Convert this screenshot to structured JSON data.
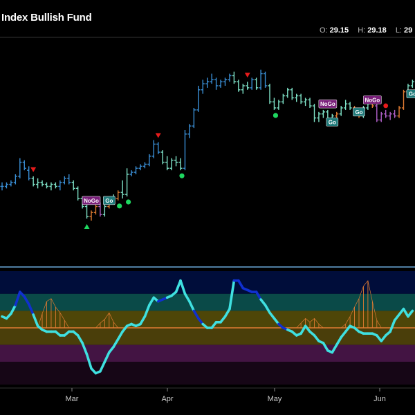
{
  "header": {
    "title": "Index Bullish Fund",
    "ohlc": [
      {
        "key": "O:",
        "value": "29.15"
      },
      {
        "key": "H:",
        "value": "29.18"
      },
      {
        "key": "L:",
        "value": "29"
      }
    ]
  },
  "colors": {
    "background": "#000000",
    "strong_go": "#3a8fd6",
    "go": "#7fe3c8",
    "nogo": "#8b44a8",
    "strong_nogo": "#b060c8",
    "neutral": "#e07b32",
    "signal_up": "#1ed760",
    "signal_down": "#e81b1b",
    "oscillator": "#3fe0e0",
    "oscillator_strong": "#1030d0",
    "zero_line": "#e07b32",
    "separator": "#6aa8d8"
  },
  "chart_data": [
    {
      "type": "ohlc",
      "title": "Index Bullish Fund",
      "x_ticks": [
        "Mar",
        "Apr",
        "May",
        "Jun"
      ],
      "ylim": [
        26.0,
        31.5
      ],
      "bars": [
        {
          "o": 27.9,
          "h": 28.0,
          "l": 27.8,
          "c": 27.9,
          "s": "sg"
        },
        {
          "o": 27.9,
          "h": 28.0,
          "l": 27.85,
          "c": 27.95,
          "s": "sg"
        },
        {
          "o": 27.95,
          "h": 28.05,
          "l": 27.9,
          "c": 28.0,
          "s": "sg"
        },
        {
          "o": 28.0,
          "h": 28.2,
          "l": 27.95,
          "c": 28.15,
          "s": "sg"
        },
        {
          "o": 28.15,
          "h": 28.6,
          "l": 28.1,
          "c": 28.5,
          "s": "sg"
        },
        {
          "o": 28.5,
          "h": 28.55,
          "l": 28.3,
          "c": 28.35,
          "s": "sg"
        },
        {
          "o": 28.3,
          "h": 28.4,
          "l": 28.05,
          "c": 28.1,
          "s": "sg"
        },
        {
          "o": 28.1,
          "h": 28.15,
          "l": 27.9,
          "c": 27.95,
          "s": "g"
        },
        {
          "o": 27.95,
          "h": 28.1,
          "l": 27.85,
          "c": 28.0,
          "s": "g"
        },
        {
          "o": 28.0,
          "h": 28.05,
          "l": 27.9,
          "c": 27.95,
          "s": "g"
        },
        {
          "o": 27.95,
          "h": 28.0,
          "l": 27.85,
          "c": 27.9,
          "s": "g"
        },
        {
          "o": 27.9,
          "h": 28.0,
          "l": 27.8,
          "c": 27.95,
          "s": "g"
        },
        {
          "o": 27.95,
          "h": 28.0,
          "l": 27.85,
          "c": 27.9,
          "s": "g"
        },
        {
          "o": 27.9,
          "h": 28.05,
          "l": 27.8,
          "c": 28.0,
          "s": "sg"
        },
        {
          "o": 28.0,
          "h": 28.15,
          "l": 27.95,
          "c": 28.1,
          "s": "sg"
        },
        {
          "o": 28.1,
          "h": 28.2,
          "l": 27.95,
          "c": 28.0,
          "s": "sg"
        },
        {
          "o": 28.0,
          "h": 28.05,
          "l": 27.8,
          "c": 27.85,
          "s": "g"
        },
        {
          "o": 27.85,
          "h": 27.9,
          "l": 27.55,
          "c": 27.6,
          "s": "g"
        },
        {
          "o": 27.6,
          "h": 27.65,
          "l": 27.35,
          "c": 27.4,
          "s": "g"
        },
        {
          "o": 27.4,
          "h": 27.45,
          "l": 27.1,
          "c": 27.15,
          "s": "g"
        },
        {
          "o": 27.15,
          "h": 27.3,
          "l": 27.05,
          "c": 27.25,
          "s": "n"
        },
        {
          "o": 27.25,
          "h": 27.45,
          "l": 27.2,
          "c": 27.4,
          "s": "n"
        },
        {
          "o": 27.4,
          "h": 27.5,
          "l": 27.15,
          "c": 27.2,
          "s": "sn"
        },
        {
          "o": 27.2,
          "h": 27.45,
          "l": 27.15,
          "c": 27.4,
          "s": "g"
        },
        {
          "o": 27.4,
          "h": 27.6,
          "l": 27.35,
          "c": 27.55,
          "s": "n"
        },
        {
          "o": 27.55,
          "h": 27.7,
          "l": 27.45,
          "c": 27.6,
          "s": "g"
        },
        {
          "o": 27.6,
          "h": 27.8,
          "l": 27.55,
          "c": 27.75,
          "s": "n"
        },
        {
          "o": 27.75,
          "h": 28.05,
          "l": 27.6,
          "c": 27.7,
          "s": "g"
        },
        {
          "o": 27.7,
          "h": 28.35,
          "l": 27.65,
          "c": 28.2,
          "s": "g"
        },
        {
          "o": 28.2,
          "h": 28.3,
          "l": 28.15,
          "c": 28.25,
          "s": "sg"
        },
        {
          "o": 28.25,
          "h": 28.4,
          "l": 28.2,
          "c": 28.35,
          "s": "sg"
        },
        {
          "o": 28.35,
          "h": 28.45,
          "l": 28.3,
          "c": 28.4,
          "s": "sg"
        },
        {
          "o": 28.4,
          "h": 28.5,
          "l": 28.35,
          "c": 28.45,
          "s": "sg"
        },
        {
          "o": 28.45,
          "h": 28.7,
          "l": 28.4,
          "c": 28.65,
          "s": "sg"
        },
        {
          "o": 28.65,
          "h": 29.05,
          "l": 28.6,
          "c": 28.95,
          "s": "sg"
        },
        {
          "o": 28.95,
          "h": 29.0,
          "l": 28.7,
          "c": 28.75,
          "s": "sg"
        },
        {
          "o": 28.75,
          "h": 28.8,
          "l": 28.45,
          "c": 28.5,
          "s": "g"
        },
        {
          "o": 28.5,
          "h": 28.65,
          "l": 28.3,
          "c": 28.35,
          "s": "g"
        },
        {
          "o": 28.35,
          "h": 28.6,
          "l": 28.3,
          "c": 28.55,
          "s": "g"
        },
        {
          "o": 28.55,
          "h": 28.65,
          "l": 28.4,
          "c": 28.5,
          "s": "g"
        },
        {
          "o": 28.5,
          "h": 28.6,
          "l": 28.3,
          "c": 28.35,
          "s": "g"
        },
        {
          "o": 28.35,
          "h": 29.3,
          "l": 28.3,
          "c": 29.2,
          "s": "sg"
        },
        {
          "o": 29.2,
          "h": 29.45,
          "l": 29.1,
          "c": 29.4,
          "s": "sg"
        },
        {
          "o": 29.4,
          "h": 29.85,
          "l": 29.35,
          "c": 29.8,
          "s": "sg"
        },
        {
          "o": 29.8,
          "h": 30.4,
          "l": 29.75,
          "c": 30.3,
          "s": "sg"
        },
        {
          "o": 30.3,
          "h": 30.55,
          "l": 30.2,
          "c": 30.45,
          "s": "sg"
        },
        {
          "o": 30.45,
          "h": 30.6,
          "l": 30.35,
          "c": 30.5,
          "s": "sg"
        },
        {
          "o": 30.5,
          "h": 30.7,
          "l": 30.45,
          "c": 30.55,
          "s": "sg"
        },
        {
          "o": 30.55,
          "h": 30.6,
          "l": 30.3,
          "c": 30.4,
          "s": "sg"
        },
        {
          "o": 30.4,
          "h": 30.55,
          "l": 30.35,
          "c": 30.5,
          "s": "sg"
        },
        {
          "o": 30.5,
          "h": 30.6,
          "l": 30.4,
          "c": 30.55,
          "s": "sg"
        },
        {
          "o": 30.55,
          "h": 30.7,
          "l": 30.5,
          "c": 30.65,
          "s": "sg"
        },
        {
          "o": 30.65,
          "h": 30.75,
          "l": 30.45,
          "c": 30.5,
          "s": "g"
        },
        {
          "o": 30.5,
          "h": 30.55,
          "l": 30.25,
          "c": 30.3,
          "s": "g"
        },
        {
          "o": 30.3,
          "h": 30.45,
          "l": 30.2,
          "c": 30.4,
          "s": "g"
        },
        {
          "o": 30.4,
          "h": 30.5,
          "l": 30.3,
          "c": 30.35,
          "s": "g"
        },
        {
          "o": 30.35,
          "h": 30.6,
          "l": 30.3,
          "c": 30.55,
          "s": "sg"
        },
        {
          "o": 30.55,
          "h": 30.6,
          "l": 30.3,
          "c": 30.35,
          "s": "g"
        },
        {
          "o": 30.35,
          "h": 30.8,
          "l": 30.3,
          "c": 30.7,
          "s": "sg"
        },
        {
          "o": 30.7,
          "h": 30.75,
          "l": 30.35,
          "c": 30.4,
          "s": "sg"
        },
        {
          "o": 30.4,
          "h": 30.45,
          "l": 29.95,
          "c": 30.0,
          "s": "g"
        },
        {
          "o": 30.0,
          "h": 30.1,
          "l": 29.8,
          "c": 29.85,
          "s": "g"
        },
        {
          "o": 29.85,
          "h": 30.05,
          "l": 29.8,
          "c": 30.0,
          "s": "g"
        },
        {
          "o": 30.0,
          "h": 30.2,
          "l": 29.95,
          "c": 30.15,
          "s": "g"
        },
        {
          "o": 30.15,
          "h": 30.35,
          "l": 30.1,
          "c": 30.3,
          "s": "g"
        },
        {
          "o": 30.3,
          "h": 30.35,
          "l": 30.05,
          "c": 30.1,
          "s": "g"
        },
        {
          "o": 30.1,
          "h": 30.2,
          "l": 30.0,
          "c": 30.15,
          "s": "g"
        },
        {
          "o": 30.15,
          "h": 30.2,
          "l": 29.95,
          "c": 30.0,
          "s": "g"
        },
        {
          "o": 30.0,
          "h": 30.1,
          "l": 29.9,
          "c": 30.05,
          "s": "g"
        },
        {
          "o": 30.05,
          "h": 30.1,
          "l": 29.85,
          "c": 29.9,
          "s": "g"
        },
        {
          "o": 29.9,
          "h": 29.95,
          "l": 29.5,
          "c": 29.6,
          "s": "g"
        },
        {
          "o": 29.6,
          "h": 29.75,
          "l": 29.5,
          "c": 29.7,
          "s": "g"
        },
        {
          "o": 29.7,
          "h": 29.8,
          "l": 29.6,
          "c": 29.75,
          "s": "g"
        },
        {
          "o": 29.75,
          "h": 29.8,
          "l": 29.55,
          "c": 29.6,
          "s": "g"
        },
        {
          "o": 29.6,
          "h": 29.7,
          "l": 29.5,
          "c": 29.65,
          "s": "g"
        },
        {
          "o": 29.65,
          "h": 29.75,
          "l": 29.6,
          "c": 29.7,
          "s": "n"
        },
        {
          "o": 29.7,
          "h": 29.9,
          "l": 29.65,
          "c": 29.85,
          "s": "g"
        },
        {
          "o": 29.85,
          "h": 30.05,
          "l": 29.8,
          "c": 29.95,
          "s": "g"
        },
        {
          "o": 29.95,
          "h": 30.0,
          "l": 29.8,
          "c": 29.85,
          "s": "g"
        },
        {
          "o": 29.85,
          "h": 29.9,
          "l": 29.65,
          "c": 29.7,
          "s": "n"
        },
        {
          "o": 29.7,
          "h": 29.75,
          "l": 29.6,
          "c": 29.65,
          "s": "n"
        },
        {
          "o": 29.65,
          "h": 29.9,
          "l": 29.6,
          "c": 29.85,
          "s": "g"
        },
        {
          "o": 29.85,
          "h": 30.0,
          "l": 29.8,
          "c": 29.95,
          "s": "g"
        },
        {
          "o": 29.95,
          "h": 30.05,
          "l": 29.85,
          "c": 29.9,
          "s": "n"
        },
        {
          "o": 29.9,
          "h": 29.95,
          "l": 29.5,
          "c": 29.55,
          "s": "sn"
        },
        {
          "o": 29.55,
          "h": 29.75,
          "l": 29.5,
          "c": 29.7,
          "s": "sn"
        },
        {
          "o": 29.7,
          "h": 29.8,
          "l": 29.6,
          "c": 29.65,
          "s": "sn"
        },
        {
          "o": 29.65,
          "h": 29.75,
          "l": 29.55,
          "c": 29.7,
          "s": "sn"
        },
        {
          "o": 29.7,
          "h": 29.8,
          "l": 29.6,
          "c": 29.65,
          "s": "sn"
        },
        {
          "o": 29.65,
          "h": 29.9,
          "l": 29.6,
          "c": 29.85,
          "s": "n"
        },
        {
          "o": 29.85,
          "h": 30.3,
          "l": 29.8,
          "c": 30.25,
          "s": "n"
        },
        {
          "o": 30.25,
          "h": 30.45,
          "l": 30.2,
          "c": 30.4,
          "s": "g"
        },
        {
          "o": 30.4,
          "h": 30.55,
          "l": 30.35,
          "c": 30.5,
          "s": "g"
        }
      ],
      "signals": [
        {
          "bar": 7,
          "type": "down"
        },
        {
          "bar": 19,
          "type": "up"
        },
        {
          "bar": 26,
          "type": "dot"
        },
        {
          "bar": 28,
          "type": "dot"
        },
        {
          "bar": 35,
          "type": "down"
        },
        {
          "bar": 40,
          "type": "dot"
        },
        {
          "bar": 55,
          "type": "down"
        },
        {
          "bar": 61,
          "type": "dot"
        },
        {
          "bar": 86,
          "type": "redot"
        }
      ],
      "labels": [
        {
          "bar": 20,
          "text": "NoGo",
          "kind": "nogo",
          "price": 27.55
        },
        {
          "bar": 24,
          "text": "Go",
          "kind": "go",
          "price": 27.55
        },
        {
          "bar": 73,
          "text": "NoGo",
          "kind": "nogo",
          "price": 29.95
        },
        {
          "bar": 74,
          "text": "Go",
          "kind": "go",
          "price": 29.5
        },
        {
          "bar": 80,
          "text": "Go",
          "kind": "go",
          "price": 29.75
        },
        {
          "bar": 83,
          "text": "NoGo",
          "kind": "nogo",
          "price": 30.05
        },
        {
          "bar": 92,
          "text": "Go",
          "kind": "go",
          "price": 30.2
        }
      ]
    },
    {
      "type": "line",
      "title": "",
      "x_ticks": [
        "Mar",
        "Apr",
        "May",
        "Jun"
      ],
      "ylim": [
        -6,
        6
      ],
      "zero_line": 0,
      "oscillator": [
        1.2,
        1.0,
        1.5,
        2.4,
        3.8,
        3.3,
        2.5,
        1.4,
        0.2,
        -0.2,
        -0.4,
        -0.4,
        -0.4,
        -0.8,
        -0.8,
        -0.4,
        -0.4,
        -0.8,
        -1.6,
        -2.8,
        -4.3,
        -4.8,
        -4.6,
        -3.6,
        -2.6,
        -2.0,
        -1.2,
        -0.4,
        0.2,
        0.4,
        0.2,
        0.4,
        1.2,
        2.4,
        3.2,
        2.8,
        3.0,
        3.2,
        3.4,
        3.8,
        5.0,
        3.6,
        2.8,
        1.8,
        1.0,
        0.4,
        0.0,
        0.0,
        0.6,
        0.6,
        1.2,
        2.0,
        5.0,
        5.0,
        4.2,
        4.0,
        3.8,
        3.8,
        3.0,
        2.4,
        1.6,
        1.0,
        0.4,
        0.0,
        -0.2,
        -0.4,
        -0.8,
        -0.6,
        0.2,
        -0.4,
        -0.8,
        -1.4,
        -1.6,
        -2.4,
        -2.6,
        -1.8,
        -1.0,
        -0.4,
        0.2,
        0.0,
        -0.4,
        -0.6,
        -0.6,
        -0.6,
        -0.8,
        -1.4,
        -0.8,
        -0.4,
        0.8,
        1.4,
        2.0,
        1.2,
        1.8
      ],
      "strong": [
        false,
        false,
        false,
        true,
        true,
        true,
        true,
        true,
        false,
        false,
        false,
        false,
        false,
        false,
        false,
        false,
        false,
        false,
        false,
        false,
        false,
        false,
        false,
        false,
        false,
        false,
        false,
        false,
        false,
        false,
        false,
        false,
        false,
        false,
        false,
        true,
        true,
        true,
        false,
        false,
        false,
        false,
        false,
        true,
        true,
        true,
        false,
        false,
        false,
        false,
        false,
        false,
        true,
        true,
        true,
        true,
        true,
        true,
        true,
        false,
        false,
        false,
        true,
        true,
        true,
        false,
        false,
        false,
        false,
        false,
        false,
        false,
        false,
        false,
        false,
        false,
        false,
        false,
        false,
        false,
        false,
        false,
        false,
        false,
        false,
        false,
        false,
        false,
        false,
        false,
        false,
        false,
        false
      ],
      "histogram": [
        0,
        0,
        0,
        0,
        0,
        0,
        0,
        0,
        0,
        1.5,
        2.8,
        3.1,
        2.2,
        1.6,
        0.8,
        0,
        0,
        0,
        0,
        0,
        0,
        0,
        0.5,
        0.9,
        1.6,
        0.6,
        0,
        0,
        0,
        0,
        0,
        0,
        0,
        0,
        0,
        0,
        0,
        0,
        0,
        0,
        0,
        0,
        0,
        0,
        0,
        0,
        0,
        0,
        0,
        0,
        0,
        0,
        0,
        0,
        0,
        0,
        0,
        0,
        0,
        0,
        0,
        0,
        0,
        0,
        0,
        0,
        0,
        0.5,
        1.0,
        0.6,
        1.0,
        0.4,
        0,
        0,
        0,
        0,
        0,
        0.4,
        1.2,
        2.2,
        3.1,
        4.4,
        5.0,
        2.8,
        0.8,
        0,
        0,
        0,
        0,
        0,
        0,
        0,
        0
      ]
    }
  ]
}
